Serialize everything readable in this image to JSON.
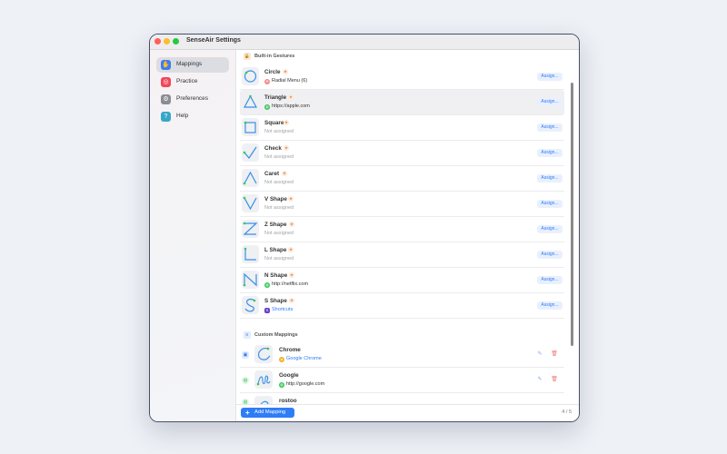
{
  "window": {
    "title": "SenseAir Settings"
  },
  "sidebar": {
    "items": [
      {
        "label": "Mappings",
        "icon": "hand-gesture-icon",
        "color": "#3d7bf5",
        "active": true
      },
      {
        "label": "Practice",
        "icon": "target-icon",
        "color": "#f0475a",
        "active": false
      },
      {
        "label": "Preferences",
        "icon": "gear-icon",
        "color": "#8a8d94",
        "active": false
      },
      {
        "label": "Help",
        "icon": "question-icon",
        "color": "#36a7c8",
        "active": false
      }
    ]
  },
  "builtin": {
    "header": "Built-in Gestures",
    "assign_label": "Assign...",
    "gestures": [
      {
        "name": "Circle",
        "mapping": "Radial Menu (6)",
        "mapping_style": "normal",
        "mapping_icon": "radial-menu-icon"
      },
      {
        "name": "Triangle",
        "mapping": "https://apple.com",
        "mapping_style": "normal",
        "mapping_icon": "globe-icon"
      },
      {
        "name": "Square",
        "mapping": "Not assigned",
        "mapping_style": "muted",
        "mapping_icon": ""
      },
      {
        "name": "Check",
        "mapping": "Not assigned",
        "mapping_style": "muted",
        "mapping_icon": ""
      },
      {
        "name": "Caret",
        "mapping": "Not assigned",
        "mapping_style": "muted",
        "mapping_icon": ""
      },
      {
        "name": "V Shape",
        "mapping": "Not assigned",
        "mapping_style": "muted",
        "mapping_icon": ""
      },
      {
        "name": "Z Shape",
        "mapping": "Not assigned",
        "mapping_style": "muted",
        "mapping_icon": ""
      },
      {
        "name": "L Shape",
        "mapping": "Not assigned",
        "mapping_style": "muted",
        "mapping_icon": ""
      },
      {
        "name": "N Shape",
        "mapping": "http://netflix.com",
        "mapping_style": "normal",
        "mapping_icon": "globe-icon"
      },
      {
        "name": "S Shape",
        "mapping": "Shortcuts",
        "mapping_style": "blue",
        "mapping_icon": "shortcuts-icon"
      }
    ]
  },
  "custom": {
    "header": "Custom Mappings",
    "items": [
      {
        "name": "Chrome",
        "mapping": "Google Chrome",
        "mapping_style": "blue",
        "type_icon": "app-icon"
      },
      {
        "name": "Google",
        "mapping": "http://google.com",
        "mapping_style": "normal",
        "type_icon": "globe-icon"
      },
      {
        "name": "rostoo",
        "mapping": "",
        "mapping_style": "normal",
        "type_icon": "globe-icon"
      }
    ]
  },
  "footer": {
    "add_label": "Add Mapping",
    "page": "4 / 5"
  },
  "colors": {
    "accent": "#2f7df6",
    "gesture_stroke": "#3a8ee6",
    "start_dot": "#34c759"
  }
}
